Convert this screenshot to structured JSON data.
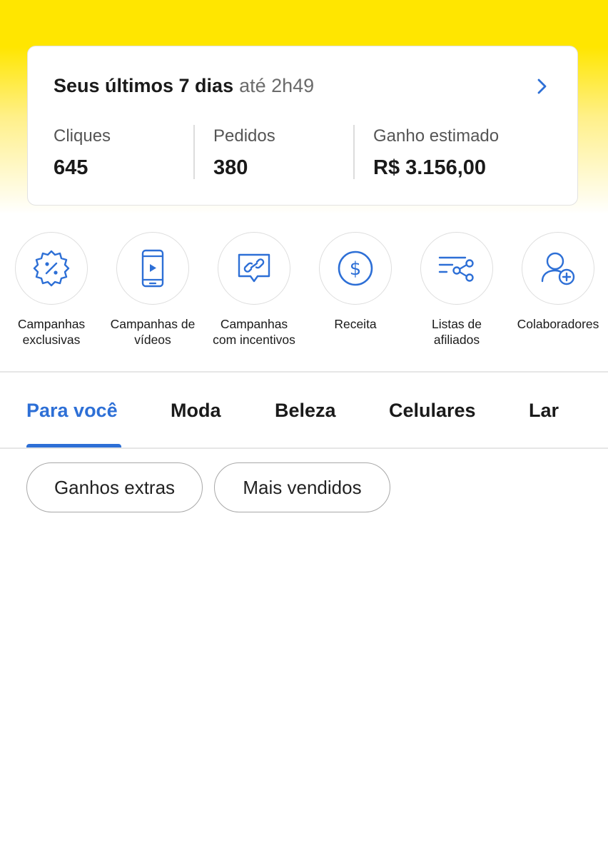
{
  "summary": {
    "title": "Seus últimos 7 dias",
    "subtitle": "até 2h49",
    "metrics": [
      {
        "label": "Cliques",
        "value": "645"
      },
      {
        "label": "Pedidos",
        "value": "380"
      },
      {
        "label": "Ganho estimado",
        "value": "R$ 3.156,00"
      }
    ]
  },
  "shortcuts": [
    {
      "line1": "Campanhas",
      "line2": "exclusivas",
      "icon": "discount-badge-icon"
    },
    {
      "line1": "Campanhas de",
      "line2": "vídeos",
      "icon": "video-phone-icon"
    },
    {
      "line1": "Campanhas",
      "line2": "com incentivos",
      "icon": "link-chat-icon"
    },
    {
      "line1": "Receita",
      "line2": "",
      "icon": "dollar-circle-icon"
    },
    {
      "line1": "Listas de",
      "line2": "afiliados",
      "icon": "list-share-icon"
    },
    {
      "line1": "Colaboradores",
      "line2": "",
      "icon": "add-user-icon"
    }
  ],
  "tabs": [
    "Para você",
    "Moda",
    "Beleza",
    "Celulares",
    "Lar"
  ],
  "active_tab": "Para você",
  "chips": [
    "Ganhos extras",
    "Mais vendidos"
  ],
  "colors": {
    "brand_yellow": "#ffe600",
    "accent_blue": "#2d6fd6"
  }
}
